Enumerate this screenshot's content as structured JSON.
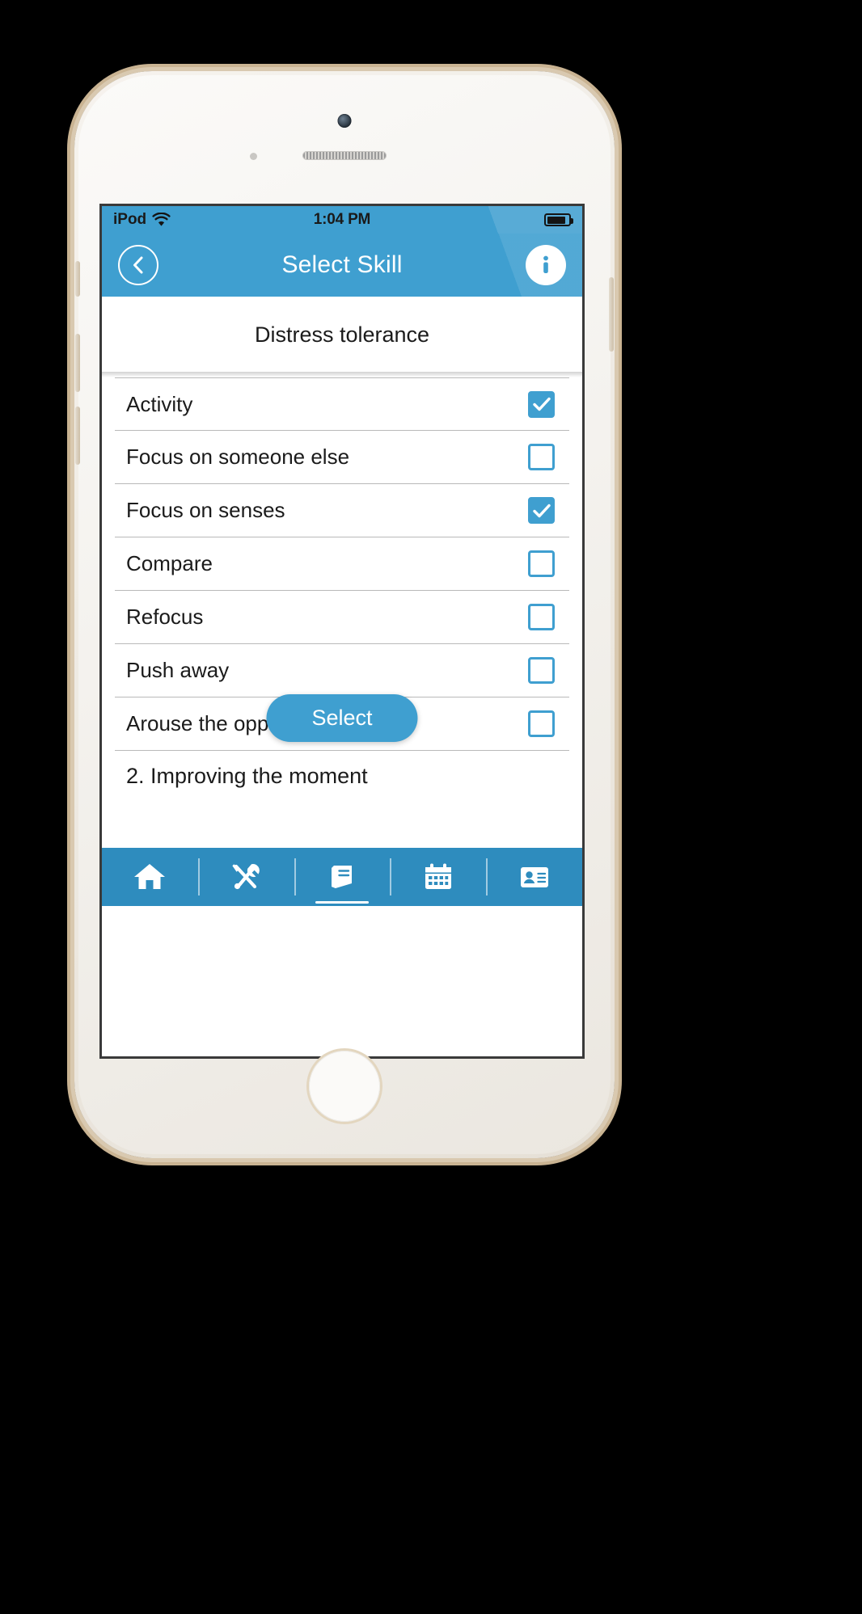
{
  "status_bar": {
    "carrier": "iPod",
    "wifi_icon": "wifi-icon",
    "time": "1:04 PM",
    "battery_icon": "battery-icon",
    "battery_level_percent": 85
  },
  "nav_bar": {
    "back_icon": "chevron-left-circle-icon",
    "title": "Select Skill",
    "info_icon": "info-circle-icon",
    "background_color": "#3f9fd0"
  },
  "section": {
    "header": "Distress tolerance"
  },
  "list": {
    "rows": [
      {
        "label": "Activity",
        "checked": true,
        "type": "item"
      },
      {
        "label": "Focus on someone else",
        "checked": false,
        "type": "item"
      },
      {
        "label": "Focus on senses",
        "checked": true,
        "type": "item"
      },
      {
        "label": "Compare",
        "checked": false,
        "type": "item"
      },
      {
        "label": "Refocus",
        "checked": false,
        "type": "item"
      },
      {
        "label": "Push away",
        "checked": false,
        "type": "item"
      },
      {
        "label": "Arouse the opposite emotion",
        "checked": false,
        "type": "item"
      }
    ],
    "group_header": "2. Improving the moment"
  },
  "select_button": {
    "label": "Select"
  },
  "tab_bar": {
    "background_color": "#2e8cbe",
    "items": [
      {
        "icon": "home-icon",
        "active": false
      },
      {
        "icon": "tools-icon",
        "active": false
      },
      {
        "icon": "book-icon",
        "active": true
      },
      {
        "icon": "calendar-icon",
        "active": false
      },
      {
        "icon": "contact-card-icon",
        "active": false
      }
    ]
  },
  "theme": {
    "accent": "#3f9fd0",
    "tab_bar": "#2e8cbe",
    "text": "#1b1b1b",
    "separator": "#b9b9b9"
  }
}
